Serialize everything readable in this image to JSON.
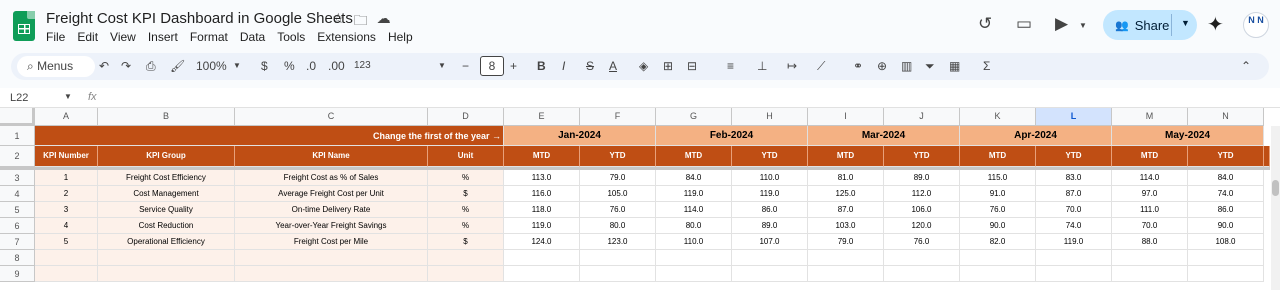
{
  "app": {
    "title": "Freight Cost KPI Dashboard in Google Sheets",
    "menu": [
      "File",
      "Edit",
      "View",
      "Insert",
      "Format",
      "Data",
      "Tools",
      "Extensions",
      "Help"
    ],
    "share_label": "Share",
    "avatar_text": "N N"
  },
  "toolbar": {
    "menus_label": "Menus",
    "zoom": "100%",
    "currency": "$",
    "percent": "%",
    "dec_decrease": ".0",
    "dec_increase": ".00",
    "number_format": "123",
    "font_size": "8",
    "bold": "B",
    "italic": "I",
    "strike": "S",
    "text_color": "A",
    "sum": "Σ"
  },
  "formula_bar": {
    "cell_ref": "L22",
    "fx": "fx",
    "value": ""
  },
  "columns": [
    "A",
    "B",
    "C",
    "D",
    "E",
    "F",
    "G",
    "H",
    "I",
    "J",
    "K",
    "L",
    "M",
    "N"
  ],
  "selected_column": "L",
  "rows": [
    "1",
    "2",
    "3",
    "4",
    "5",
    "6",
    "7",
    "8",
    "9"
  ],
  "sheet": {
    "row1_label": "Change the first of the year →",
    "months": [
      "Jan-2024",
      "Feb-2024",
      "Mar-2024",
      "Apr-2024",
      "May-2024"
    ],
    "headers": [
      "KPI Number",
      "KPI Group",
      "KPI Name",
      "Unit"
    ],
    "sub_headers": [
      "MTD",
      "YTD",
      "MTD",
      "YTD",
      "MTD",
      "YTD",
      "MTD",
      "YTD",
      "MTD",
      "YTD"
    ],
    "data_rows": [
      {
        "num": "1",
        "group": "Freight Cost Efficiency",
        "name": "Freight Cost as % of Sales",
        "unit": "%",
        "vals": [
          "113.0",
          "79.0",
          "84.0",
          "110.0",
          "81.0",
          "89.0",
          "115.0",
          "83.0",
          "114.0",
          "84.0"
        ]
      },
      {
        "num": "2",
        "group": "Cost Management",
        "name": "Average Freight Cost per Unit",
        "unit": "$",
        "vals": [
          "116.0",
          "105.0",
          "119.0",
          "119.0",
          "125.0",
          "112.0",
          "91.0",
          "87.0",
          "97.0",
          "74.0"
        ]
      },
      {
        "num": "3",
        "group": "Service Quality",
        "name": "On-time Delivery Rate",
        "unit": "%",
        "vals": [
          "118.0",
          "76.0",
          "114.0",
          "86.0",
          "87.0",
          "106.0",
          "76.0",
          "70.0",
          "111.0",
          "86.0"
        ]
      },
      {
        "num": "4",
        "group": "Cost Reduction",
        "name": "Year-over-Year Freight Savings",
        "unit": "%",
        "vals": [
          "119.0",
          "80.0",
          "80.0",
          "89.0",
          "103.0",
          "120.0",
          "90.0",
          "74.0",
          "70.0",
          "90.0"
        ]
      },
      {
        "num": "5",
        "group": "Operational Efficiency",
        "name": "Freight Cost per Mile",
        "unit": "$",
        "vals": [
          "124.0",
          "123.0",
          "110.0",
          "107.0",
          "79.0",
          "76.0",
          "82.0",
          "119.0",
          "88.0",
          "108.0"
        ]
      }
    ]
  },
  "colors": {
    "header_dark": "#bf4e14",
    "header_month": "#f4b183",
    "peach": "#fdf1ea",
    "share": "#c2e7ff"
  }
}
